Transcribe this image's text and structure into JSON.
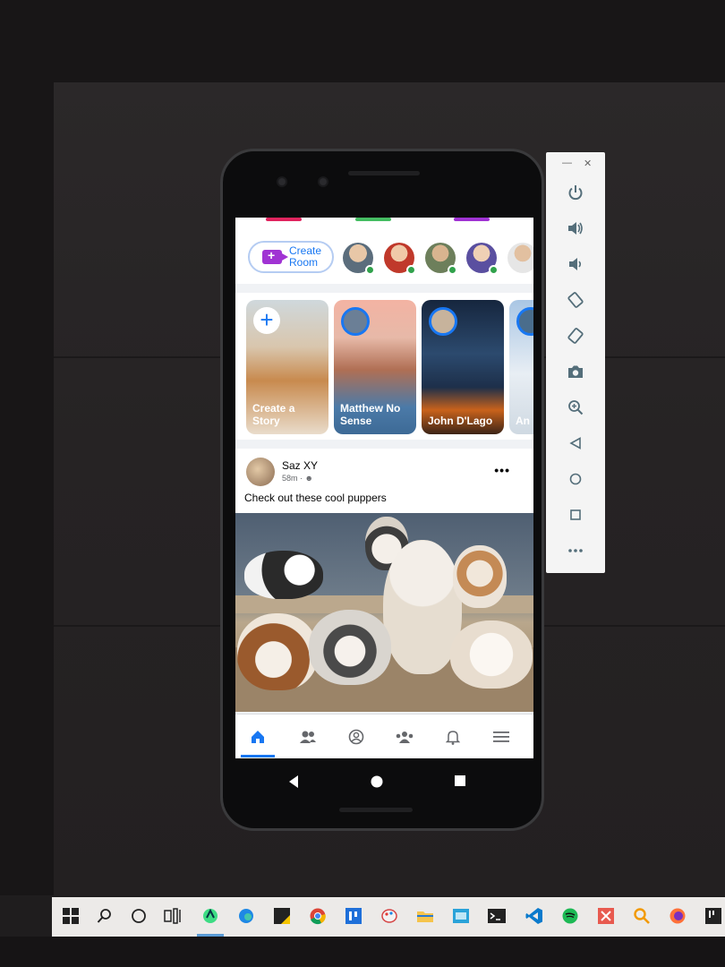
{
  "rooms": {
    "create_room_label": "Create Room"
  },
  "stories": [
    {
      "label": "Create a Story"
    },
    {
      "label": "Matthew No Sense"
    },
    {
      "label": "John D'Lago"
    },
    {
      "label": "An"
    }
  ],
  "post": {
    "author": "Saz XY",
    "time": "58m",
    "text": "Check out these cool puppers"
  },
  "bottom_nav": [
    "home-icon",
    "friends-icon",
    "profile-icon",
    "groups-icon",
    "notifications-icon",
    "menu-icon"
  ],
  "android_nav": [
    "back-icon",
    "home-circle-icon",
    "recents-icon"
  ],
  "emulator_toolbar": [
    "minimize-icon",
    "close-icon",
    "power-icon",
    "volume-up-icon",
    "volume-down-icon",
    "rotate-left-icon",
    "rotate-right-icon",
    "camera-icon",
    "zoom-icon",
    "back-icon",
    "home-icon",
    "overview-icon",
    "more-icon"
  ],
  "taskbar": [
    "windows-icon",
    "search-icon",
    "cortana-icon",
    "task-view-icon",
    "android-studio-icon",
    "edge-icon",
    "sticky-app-icon",
    "chrome-icon",
    "app-icon",
    "paint-icon",
    "file-explorer-icon",
    "app-icon-2",
    "terminal-icon",
    "vscode-icon",
    "spotify-icon",
    "app-icon-3",
    "search-app-icon",
    "firefox-icon",
    "app-icon-4"
  ],
  "colors": {
    "facebook_blue": "#1877f2",
    "online_green": "#31a24c",
    "room_purple": "#a033d3"
  }
}
